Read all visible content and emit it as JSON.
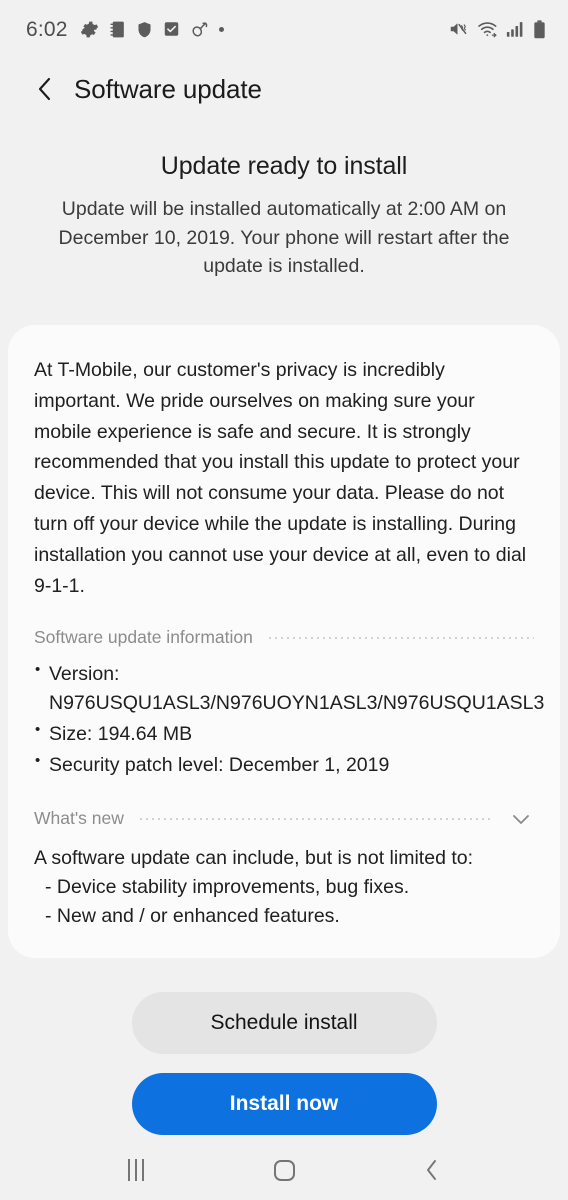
{
  "statusbar": {
    "time": "6:02",
    "left_icons": [
      {
        "name": "gear-icon"
      },
      {
        "name": "notebook-icon"
      },
      {
        "name": "shield-icon"
      },
      {
        "name": "checkbox-icon"
      },
      {
        "name": "link-icon"
      },
      {
        "name": "dot-indicator-icon"
      }
    ],
    "right_icons": [
      {
        "name": "mute-vibrate-icon"
      },
      {
        "name": "wifi-icon"
      },
      {
        "name": "signal-bars-icon"
      },
      {
        "name": "battery-icon"
      }
    ]
  },
  "header": {
    "title": "Software update",
    "back_icon": "back-chevron-icon"
  },
  "hero": {
    "title": "Update ready to install",
    "subtitle": "Update will be installed automatically at 2:00 AM on December 10, 2019. Your phone will restart after the update is installed."
  },
  "card": {
    "paragraph": "At T-Mobile, our customer's privacy is incredibly important. We pride ourselves on making sure your mobile experience is safe and secure. It is strongly recommended that you install this update to protect your device. This will not consume your data. Please do not turn off your device while the update is installing. During installation you cannot use your device at all, even to dial 9-1-1.",
    "info_section": {
      "label": "Software update information",
      "items": [
        "Version: N976USQU1ASL3/N976UOYN1ASL3/N976USQU1ASL3",
        "Size: 194.64 MB",
        "Security patch level: December 1, 2019"
      ]
    },
    "whats_new": {
      "label": "What's new",
      "expand_icon": "chevron-down-icon",
      "lead": "A software update can include, but is not limited to:",
      "items": [
        "- Device stability improvements, bug fixes.",
        "- New and / or enhanced features."
      ]
    }
  },
  "actions": {
    "schedule_label": "Schedule install",
    "install_label": "Install now",
    "primary_color": "#0d72e0",
    "secondary_color": "#e4e4e4"
  },
  "navbar": {
    "recents_name": "recents-icon",
    "home_name": "home-icon",
    "back_name": "back-icon"
  }
}
